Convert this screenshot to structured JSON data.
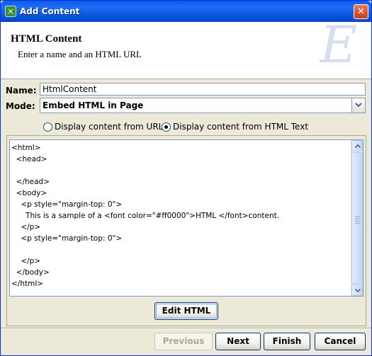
{
  "window": {
    "title": "Add Content",
    "close_glyph": "✕",
    "icon": "wand-sparkle-icon"
  },
  "header": {
    "title": "HTML Content",
    "subtitle": "Enter a name and an HTML URL",
    "watermark": "E"
  },
  "form": {
    "name_label": "Name:",
    "name_value": "HtmlContent",
    "mode_label": "Mode:",
    "mode_value": "Embed HTML in Page"
  },
  "radios": [
    {
      "label": "Display content from URL",
      "checked": false
    },
    {
      "label": "Display content from HTML Text",
      "checked": true
    }
  ],
  "editor": {
    "content": "<html>\n  <head>\n\n  </head>\n  <body>\n    <p style=\"margin-top: 0\">\n      This is a sample of a <font color=\"#ff0000\">HTML </font>content.\n    </p>\n    <p style=\"margin-top: 0\">\n\n    </p>\n  </body>\n</html>"
  },
  "buttons": {
    "edit_html": "Edit HTML",
    "previous": "Previous",
    "next": "Next",
    "finish": "Finish",
    "cancel": "Cancel"
  },
  "colors": {
    "titlebar": "#0a5be8",
    "window_bg": "#ece9d8",
    "border": "#7f9db9"
  }
}
